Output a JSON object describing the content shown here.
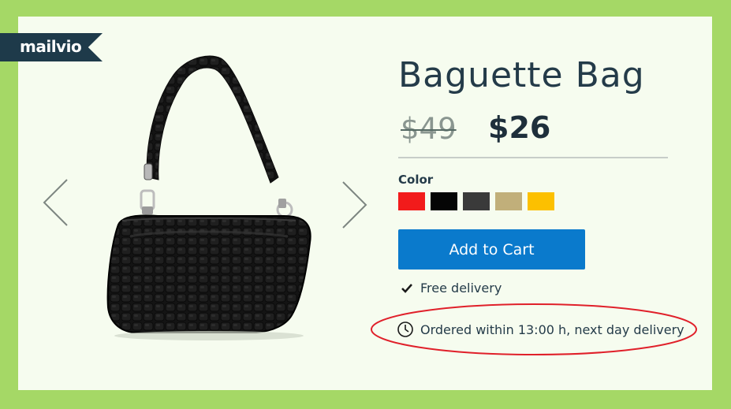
{
  "brand": {
    "name": "mailvio"
  },
  "product": {
    "title": "Baguette Bag",
    "old_price": "$49",
    "new_price": "$26"
  },
  "color": {
    "label": "Color",
    "swatches": [
      {
        "name": "red",
        "hex": "#f21b1b"
      },
      {
        "name": "black",
        "hex": "#050505"
      },
      {
        "name": "dark-gray",
        "hex": "#3a3a3a"
      },
      {
        "name": "tan",
        "hex": "#c1af7a"
      },
      {
        "name": "yellow",
        "hex": "#fcc000"
      }
    ]
  },
  "cart": {
    "label": "Add to Cart",
    "color": "#0a7acc"
  },
  "delivery": {
    "free": "Free delivery",
    "order_notice": "Ordered within 13:00 h, next day delivery"
  },
  "icons": {
    "prev": "chevron-left-icon",
    "next": "chevron-right-icon",
    "check": "checkmark-icon",
    "clock": "clock-icon"
  },
  "colors": {
    "background": "#a5d866",
    "card": "#f6fcef",
    "highlight": "#e0202a",
    "text": "#243b49"
  }
}
